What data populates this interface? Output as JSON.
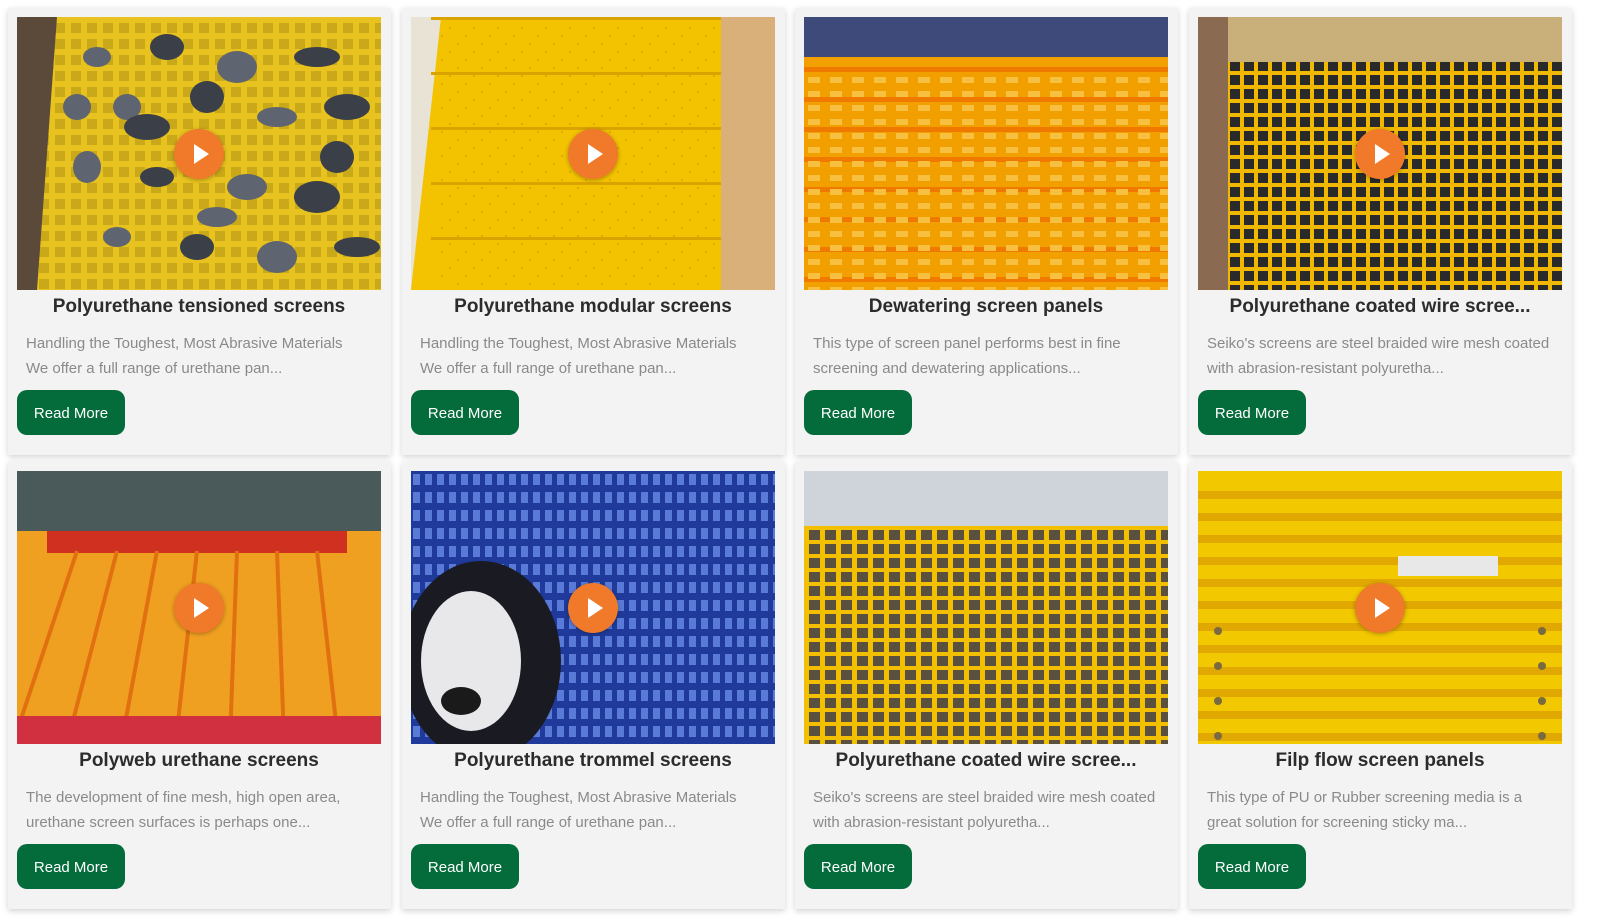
{
  "products": [
    {
      "title": "Polyurethane tensioned screens",
      "desc": [
        "Handling the Toughest, Most Abrasive Materials",
        "We offer a full range of urethane pan..."
      ],
      "button": "Read More",
      "image": "rocks-on-yellow-grid",
      "has_video": true
    },
    {
      "title": "Polyurethane modular screens",
      "desc": [
        "Handling the Toughest, Most Abrasive Materials",
        "We offer a full range of urethane pan..."
      ],
      "button": "Read More",
      "image": "yellow-modular-panels",
      "has_video": true
    },
    {
      "title": "Dewatering screen panels",
      "desc": [
        "This type of screen panel performs best in fine",
        "screening and dewatering applications..."
      ],
      "button": "Read More",
      "image": "orange-dewatering-deck",
      "has_video": false
    },
    {
      "title": "Polyurethane coated wire scree...",
      "desc": [
        "Seiko's screens are steel braided wire mesh coated",
        "with abrasion-resistant polyuretha..."
      ],
      "button": "Read More",
      "image": "yellow-coated-wire-mesh",
      "has_video": true
    },
    {
      "title": "Polyweb urethane screens",
      "desc": [
        "The development of fine mesh, high open area,",
        "urethane screen surfaces is perhaps one..."
      ],
      "button": "Read More",
      "image": "orange-polyweb-screen",
      "has_video": true
    },
    {
      "title": "Polyurethane trommel screens",
      "desc": [
        "Handling the Toughest, Most Abrasive Materials",
        "We offer a full range of urethane pan..."
      ],
      "button": "Read More",
      "image": "blue-trommel-drum",
      "has_video": true
    },
    {
      "title": "Polyurethane coated wire scree...",
      "desc": [
        "Seiko's screens are steel braided wire mesh coated",
        "with abrasion-resistant polyuretha..."
      ],
      "button": "Read More",
      "image": "yellow-wire-grid-deck",
      "has_video": false
    },
    {
      "title": "Filp flow screen panels",
      "desc": [
        "This type of PU or Rubber screening media is a",
        "great solution for screening sticky ma..."
      ],
      "button": "Read More",
      "image": "yellow-flip-flow-deck",
      "has_video": true
    }
  ],
  "colors": {
    "button_bg": "#046b3a",
    "play_bg": "#f07a2a",
    "card_bg": "#f3f3f3"
  }
}
